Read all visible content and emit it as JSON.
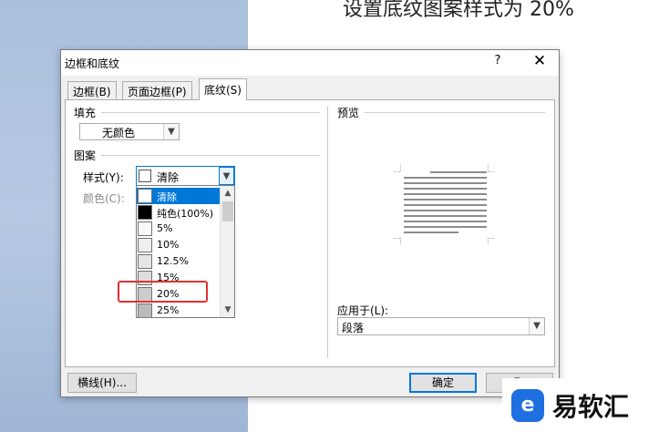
{
  "document": {
    "caption": "设置底纹图案样式为 20%"
  },
  "dialog": {
    "title": "边框和底纹",
    "help_label": "?",
    "close_label": "✕",
    "tabs": [
      {
        "label": "边框(B)",
        "active": false
      },
      {
        "label": "页面边框(P)",
        "active": false
      },
      {
        "label": "底纹(S)",
        "active": true
      }
    ],
    "fill": {
      "group_label": "填充",
      "value": "无颜色"
    },
    "pattern": {
      "group_label": "图案",
      "style_label": "样式(Y):",
      "style_value": "清除",
      "color_label": "颜色(C):",
      "options": [
        {
          "label": "清除",
          "swatch": "#ffffff",
          "selected": true
        },
        {
          "label": "纯色(100%)",
          "swatch": "#000000",
          "selected": false
        },
        {
          "label": "5%",
          "swatch": "#f8f8f8",
          "selected": false
        },
        {
          "label": "10%",
          "swatch": "#eeeeee",
          "selected": false
        },
        {
          "label": "12.5%",
          "swatch": "#e6e6e6",
          "selected": false
        },
        {
          "label": "15%",
          "swatch": "#dedede",
          "selected": false
        },
        {
          "label": "20%",
          "swatch": "#cccccc",
          "selected": false
        },
        {
          "label": "25%",
          "swatch": "#bbbbbb",
          "selected": false
        }
      ]
    },
    "preview": {
      "label": "预览"
    },
    "apply_to": {
      "label": "应用于(L):",
      "value": "段落"
    },
    "buttons": {
      "horizontal_line": "横线(H)...",
      "ok": "确定",
      "cancel": "取"
    }
  },
  "watermark": {
    "text": "易软汇",
    "logo": "e"
  },
  "colors": {
    "selection": "#0078d7",
    "highlight_box": "#e53030",
    "watermark_blue": "#1e6fe0"
  }
}
